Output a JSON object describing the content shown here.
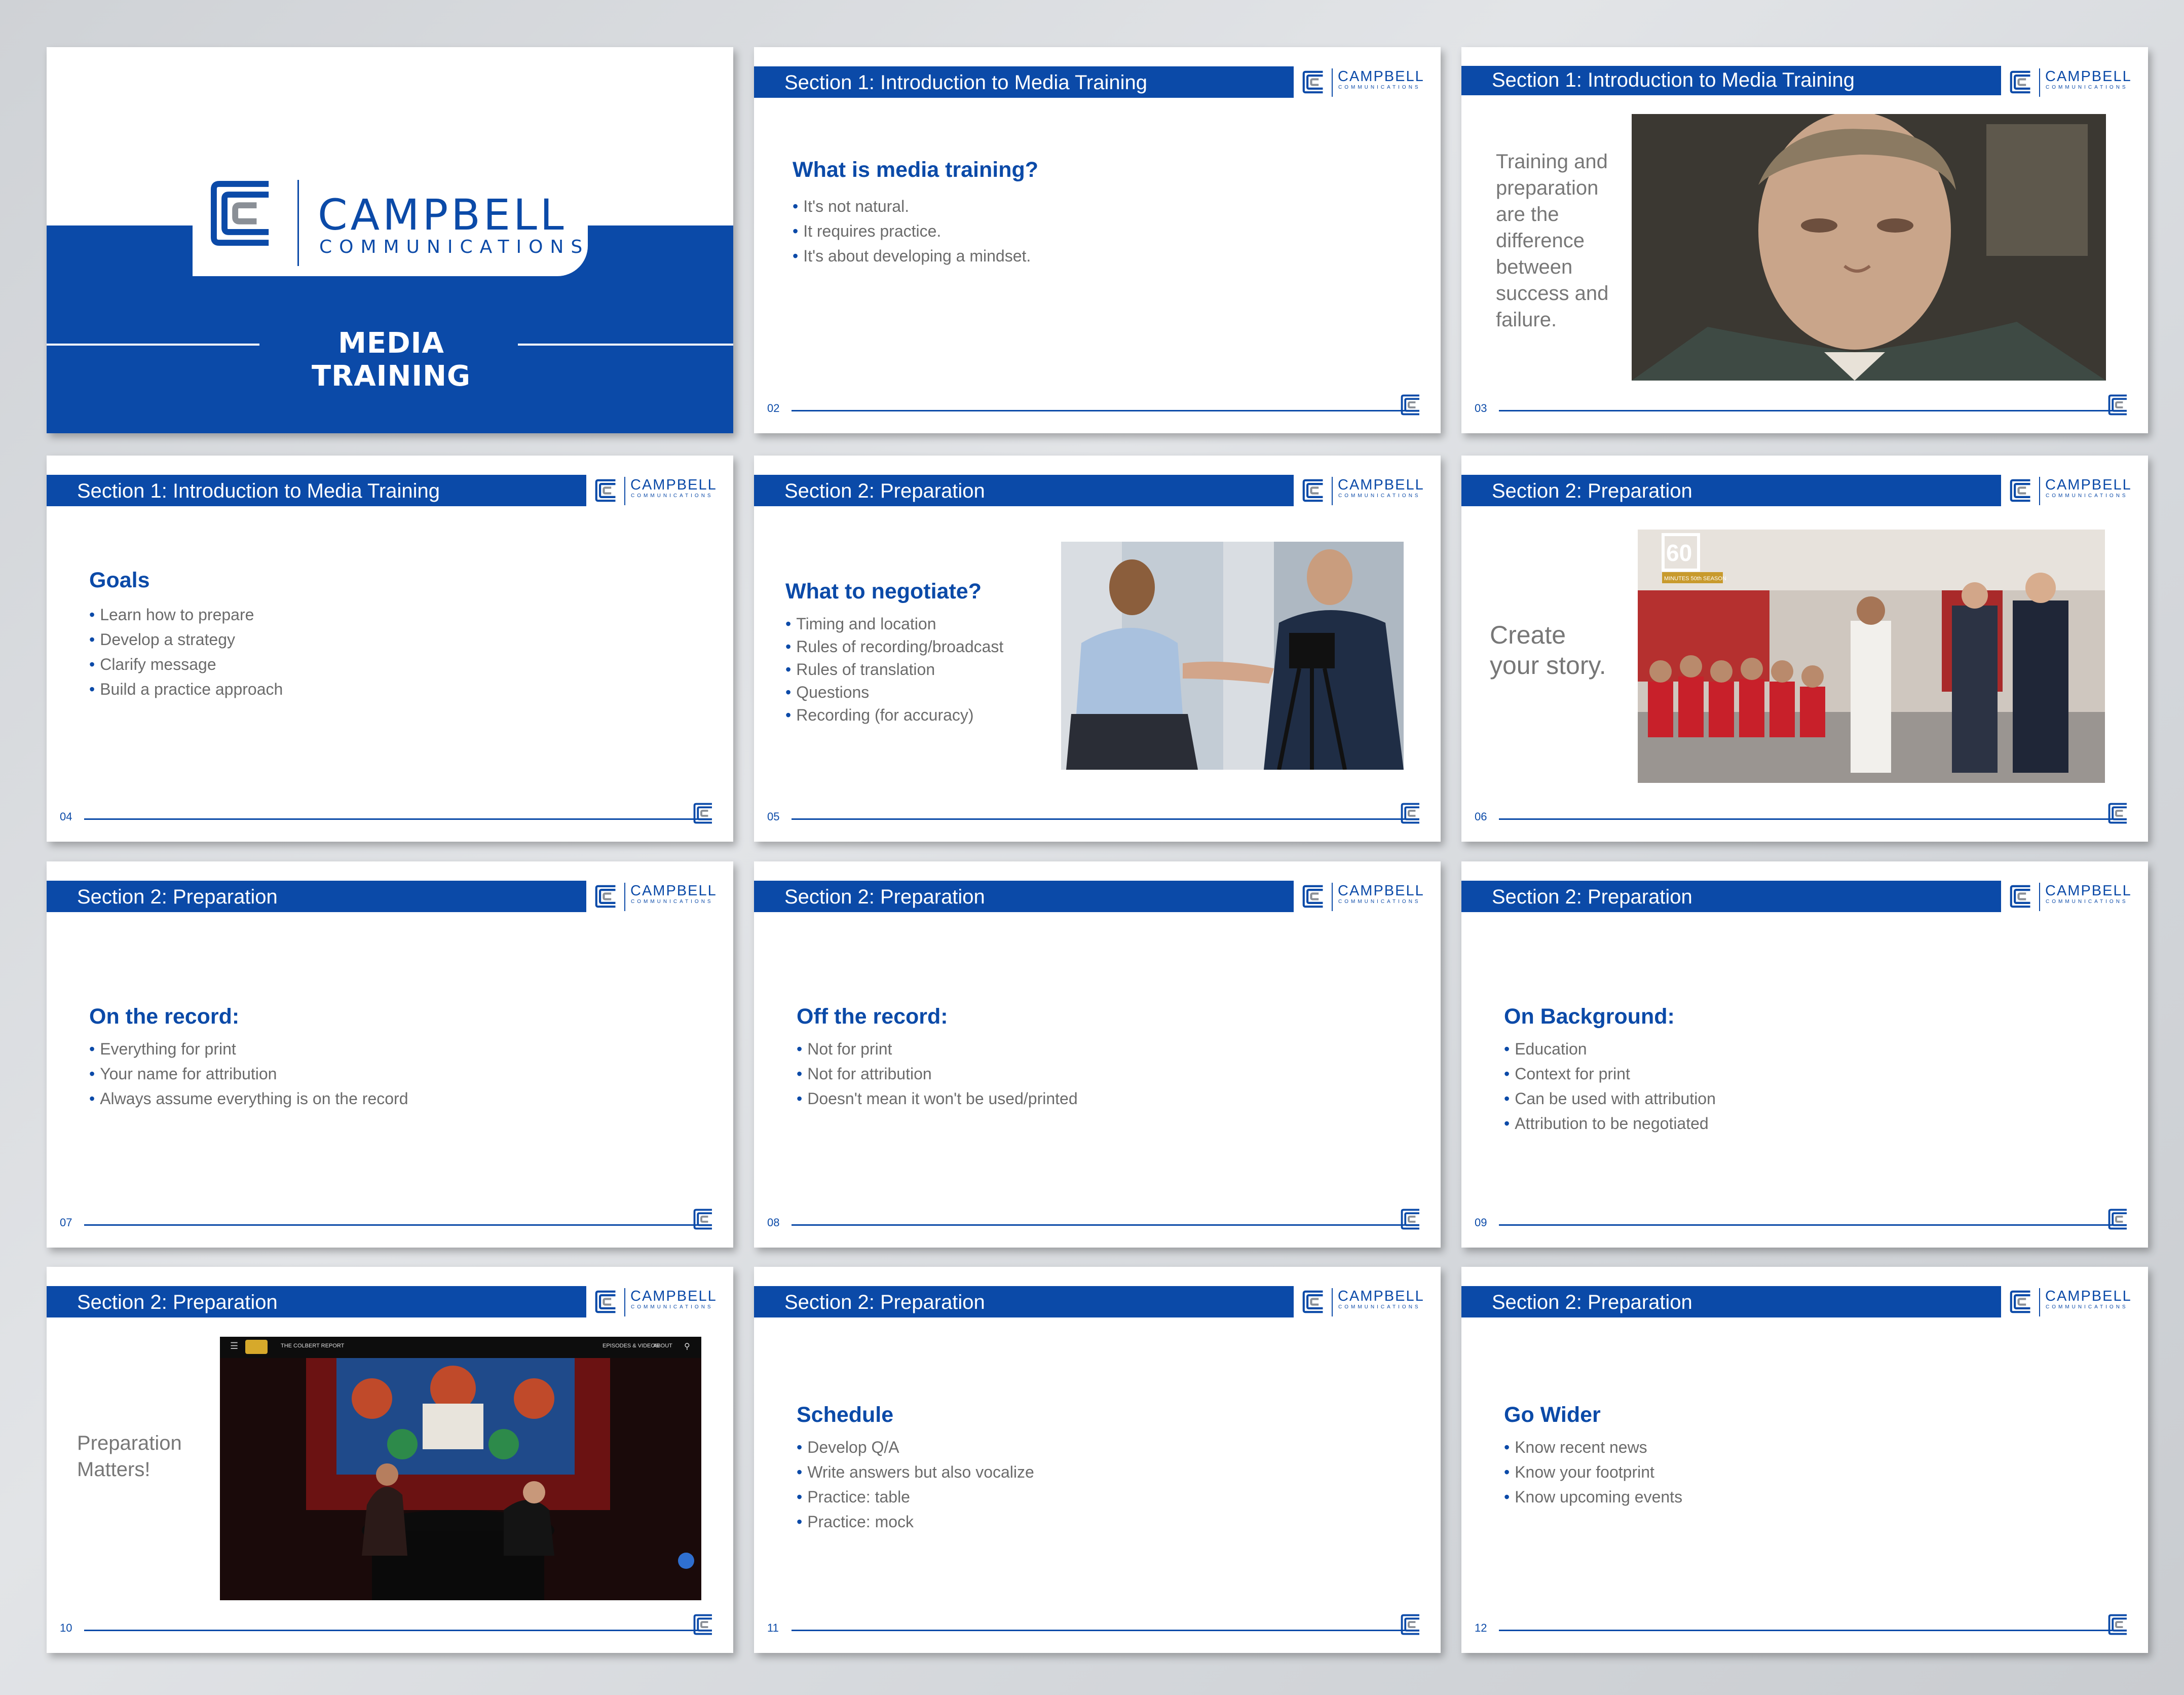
{
  "brand": {
    "name": "CAMPBELL",
    "subtitle": "COMMUNICATIONS",
    "color": "#0b4aa8"
  },
  "title_slide": {
    "title": "MEDIA TRAINING"
  },
  "slides": [
    {
      "number": "02",
      "section": "Section 1: Introduction to Media Training",
      "heading": "What is media training?",
      "bullets": [
        "It's not natural.",
        "It requires practice.",
        "It's about developing a mindset."
      ]
    },
    {
      "number": "03",
      "section": "Section 1: Introduction to Media Training",
      "quote": [
        "Training and",
        "preparation",
        "are the",
        "difference",
        "between",
        "success and",
        "failure."
      ]
    },
    {
      "number": "04",
      "section": "Section 1: Introduction to Media Training",
      "heading": "Goals",
      "bullets": [
        "Learn how to prepare",
        "Develop a strategy",
        "Clarify message",
        "Build a practice approach"
      ]
    },
    {
      "number": "05",
      "section": "Section 2: Preparation",
      "heading": "What to negotiate?",
      "bullets": [
        "Timing and location",
        "Rules of recording/broadcast",
        "Rules of translation",
        "Questions",
        "Recording (for accuracy)"
      ]
    },
    {
      "number": "06",
      "section": "Section 2: Preparation",
      "quote": [
        "Create",
        "your story."
      ],
      "photo_badge": "60",
      "photo_badge_sub": "MINUTES 50th SEASON"
    },
    {
      "number": "07",
      "section": "Section 2: Preparation",
      "heading": "On the record:",
      "bullets": [
        "Everything for print",
        "Your name for attribution",
        "Always assume everything is on the record"
      ]
    },
    {
      "number": "08",
      "section": "Section 2: Preparation",
      "heading": "Off the record:",
      "bullets": [
        "Not for print",
        "Not for attribution",
        "Doesn't mean it won't be used/printed"
      ]
    },
    {
      "number": "09",
      "section": "Section 2: Preparation",
      "heading": "On Background:",
      "bullets": [
        "Education",
        "Context for print",
        "Can be used with attribution",
        "Attribution to be negotiated"
      ]
    },
    {
      "number": "10",
      "section": "Section 2: Preparation",
      "quote": [
        "Preparation",
        "Matters!"
      ],
      "video_bar": {
        "show": "THE COLBERT REPORT",
        "nav1": "EPISODES & VIDEOS",
        "nav2": "ABOUT"
      }
    },
    {
      "number": "11",
      "section": "Section 2: Preparation",
      "heading": "Schedule",
      "bullets": [
        "Develop Q/A",
        "Write answers but also vocalize",
        "Practice: table",
        "Practice: mock"
      ]
    },
    {
      "number": "12",
      "section": "Section 2: Preparation",
      "heading": "Go Wider",
      "bullets": [
        "Know recent news",
        "Know your footprint",
        "Know upcoming events"
      ]
    }
  ]
}
